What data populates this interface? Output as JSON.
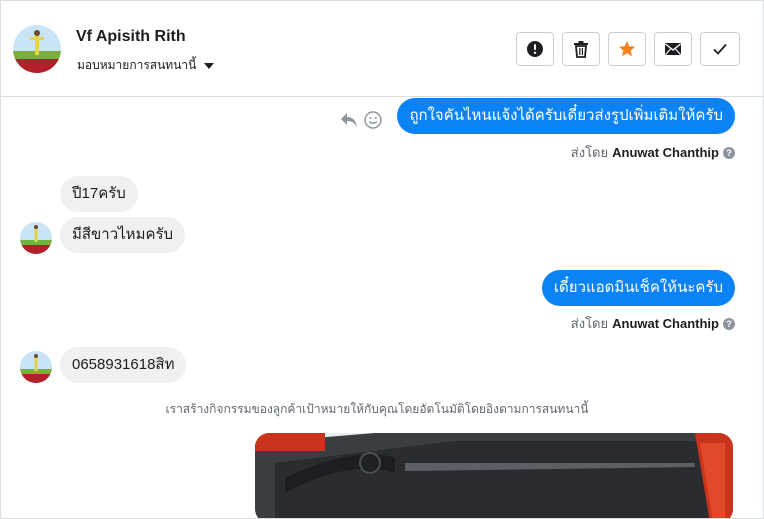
{
  "header": {
    "contact_name": "Vf Apisith Rith",
    "assign_label": "มอบหมายการสนทนานี้",
    "actions": [
      {
        "name": "mark-spam",
        "icon": "exclamation-circle-icon"
      },
      {
        "name": "delete",
        "icon": "trash-icon"
      },
      {
        "name": "star",
        "icon": "star-icon",
        "color": "#f5821f"
      },
      {
        "name": "mark-unread",
        "icon": "envelope-icon"
      },
      {
        "name": "mark-done",
        "icon": "check-icon"
      }
    ]
  },
  "thread": {
    "msg_out_1": "ถูกใจคันไหนแจ้งได้ครับเดี๋ยวส่งรูปเพิ่มเติมให้ครับ",
    "sent_by_prefix_1": "ส่งโดย",
    "sent_by_name_1": "Anuwat Chanthip",
    "msg_in_1": "ปี17ครับ",
    "msg_in_2": "มีสีขาวไหมครับ",
    "msg_out_2": "เดี๋ยวแอดมินเช็คให้นะครับ",
    "sent_by_prefix_2": "ส่งโดย",
    "sent_by_name_2": "Anuwat Chanthip",
    "msg_in_3": "0658931618สิท",
    "system_note": "เราสร้างกิจกรรมของลูกค้าเป้าหมายให้กับคุณโดยอัตโนมัติโดยอิงตามการสนทนานี้"
  },
  "colors": {
    "outgoing_bubble": "#0b83f5",
    "incoming_bubble": "#f0f0f0",
    "star_accent": "#f5821f"
  }
}
